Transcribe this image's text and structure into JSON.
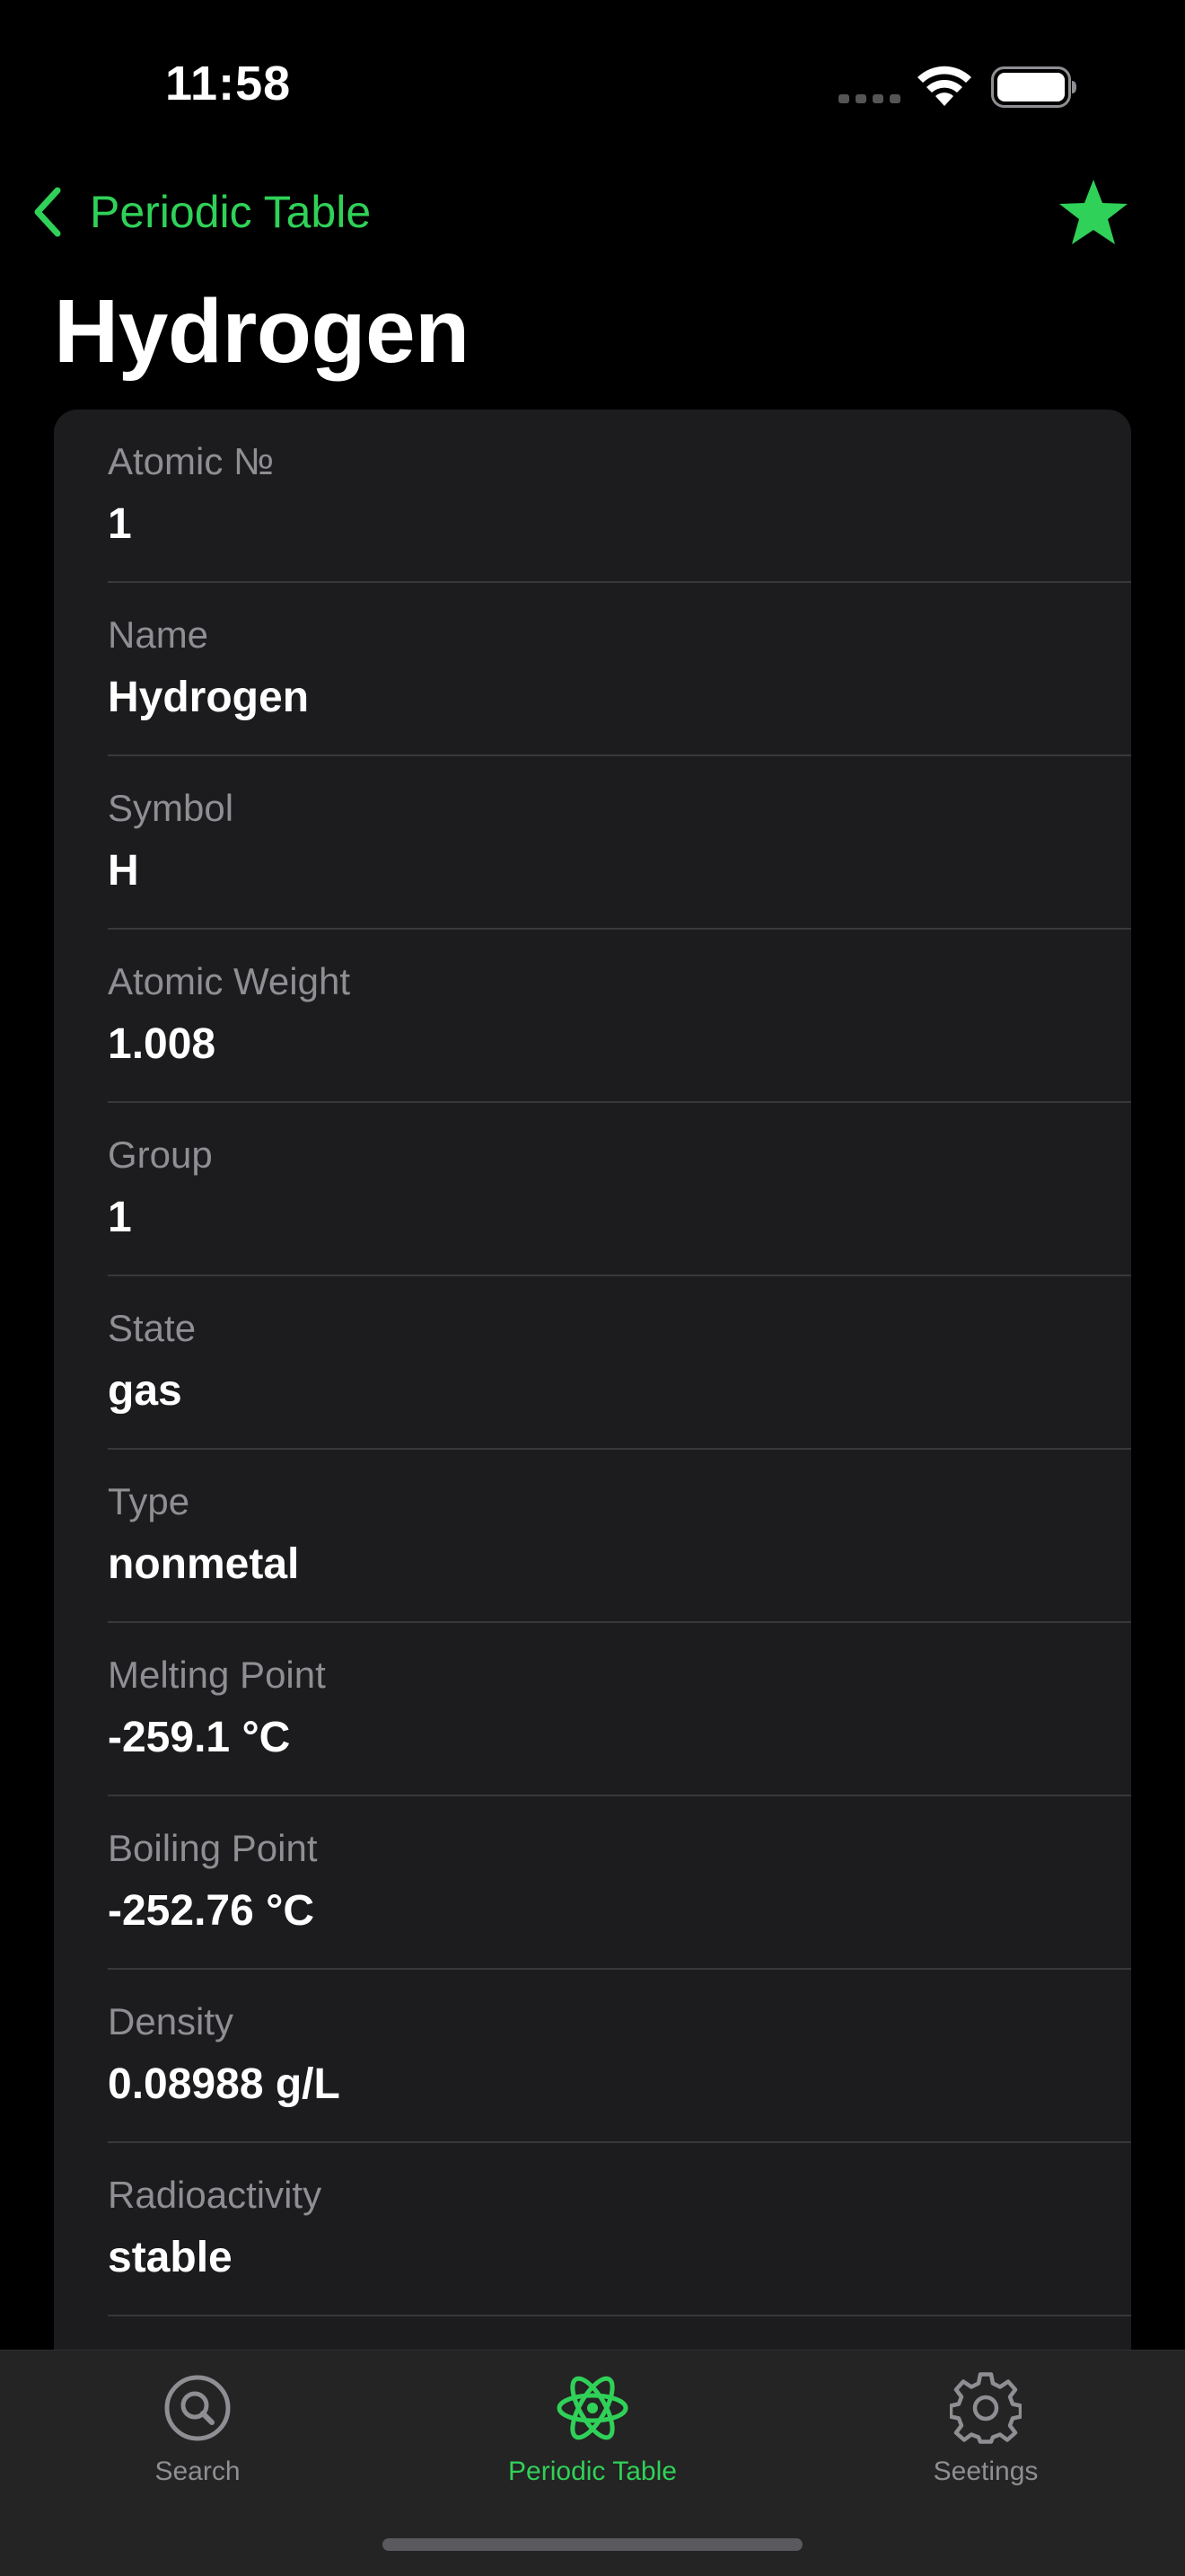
{
  "status_bar": {
    "time": "11:58"
  },
  "nav": {
    "back_label": "Periodic Table",
    "favorite_icon": "star-icon"
  },
  "page": {
    "title": "Hydrogen"
  },
  "details": [
    {
      "label": "Atomic №",
      "value": "1"
    },
    {
      "label": "Name",
      "value": "Hydrogen"
    },
    {
      "label": "Symbol",
      "value": "H"
    },
    {
      "label": "Atomic Weight",
      "value": "1.008"
    },
    {
      "label": "Group",
      "value": "1"
    },
    {
      "label": "State",
      "value": "gas"
    },
    {
      "label": "Type",
      "value": "nonmetal"
    },
    {
      "label": "Melting Point",
      "value": "-259.1 °C"
    },
    {
      "label": "Boiling Point",
      "value": "-252.76 °C"
    },
    {
      "label": "Density",
      "value": "0.08988 g/L"
    },
    {
      "label": "Radioactivity",
      "value": "stable"
    }
  ],
  "tab_bar": {
    "tabs": [
      {
        "label": "Search",
        "icon": "search-icon",
        "active": false
      },
      {
        "label": "Periodic Table",
        "icon": "atom-icon",
        "active": true
      },
      {
        "label": "Seetings",
        "icon": "gear-icon",
        "active": false
      }
    ]
  },
  "colors": {
    "accent": "#30d158",
    "background": "#000000",
    "card": "#1c1c1e",
    "secondary_text": "#8e8e93",
    "tab_bar": "#242424"
  }
}
